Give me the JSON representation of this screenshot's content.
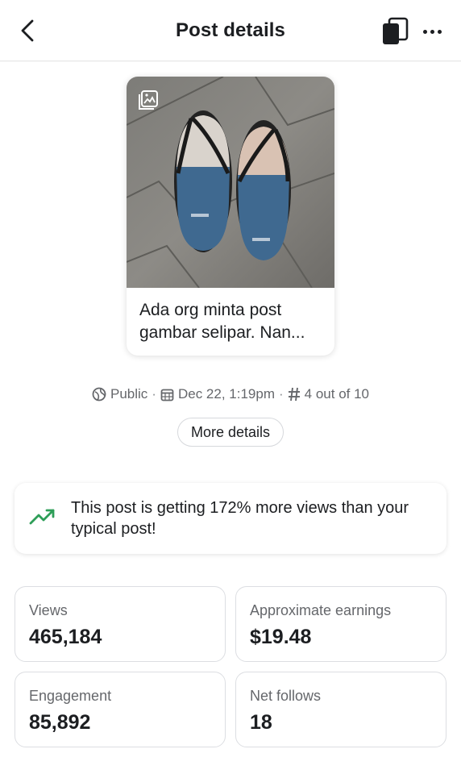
{
  "header": {
    "title": "Post details",
    "back_icon": "chevron-left-icon",
    "copy_icon": "copy-icon",
    "more_icon": "more-horizontal-icon"
  },
  "post": {
    "caption": "Ada org minta post gambar selipar. Nan...",
    "type_icon": "photo-icon",
    "image_description": "flip-flops-photo"
  },
  "meta": {
    "audience": "Public",
    "date": "Dec 22, 1:19pm",
    "rank": "4 out of 10",
    "separator": "·",
    "more_details_label": "More details"
  },
  "insight": {
    "text": "This post is getting 172% more views than your typical post!",
    "icon": "trending-up-icon",
    "accent": "#2e9e58"
  },
  "stats": [
    {
      "label": "Views",
      "value": "465,184"
    },
    {
      "label": "Approximate earnings",
      "value": "$19.48"
    },
    {
      "label": "Engagement",
      "value": "85,892"
    },
    {
      "label": "Net follows",
      "value": "18"
    }
  ]
}
